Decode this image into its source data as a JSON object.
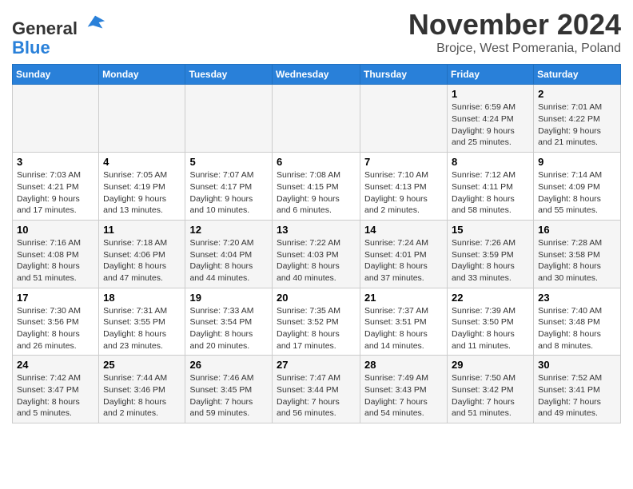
{
  "header": {
    "logo_line1": "General",
    "logo_line2": "Blue",
    "title": "November 2024",
    "subtitle": "Brojce, West Pomerania, Poland"
  },
  "weekdays": [
    "Sunday",
    "Monday",
    "Tuesday",
    "Wednesday",
    "Thursday",
    "Friday",
    "Saturday"
  ],
  "weeks": [
    {
      "days": [
        {
          "num": "",
          "info": ""
        },
        {
          "num": "",
          "info": ""
        },
        {
          "num": "",
          "info": ""
        },
        {
          "num": "",
          "info": ""
        },
        {
          "num": "",
          "info": ""
        },
        {
          "num": "1",
          "info": "Sunrise: 6:59 AM\nSunset: 4:24 PM\nDaylight: 9 hours\nand 25 minutes."
        },
        {
          "num": "2",
          "info": "Sunrise: 7:01 AM\nSunset: 4:22 PM\nDaylight: 9 hours\nand 21 minutes."
        }
      ]
    },
    {
      "days": [
        {
          "num": "3",
          "info": "Sunrise: 7:03 AM\nSunset: 4:21 PM\nDaylight: 9 hours\nand 17 minutes."
        },
        {
          "num": "4",
          "info": "Sunrise: 7:05 AM\nSunset: 4:19 PM\nDaylight: 9 hours\nand 13 minutes."
        },
        {
          "num": "5",
          "info": "Sunrise: 7:07 AM\nSunset: 4:17 PM\nDaylight: 9 hours\nand 10 minutes."
        },
        {
          "num": "6",
          "info": "Sunrise: 7:08 AM\nSunset: 4:15 PM\nDaylight: 9 hours\nand 6 minutes."
        },
        {
          "num": "7",
          "info": "Sunrise: 7:10 AM\nSunset: 4:13 PM\nDaylight: 9 hours\nand 2 minutes."
        },
        {
          "num": "8",
          "info": "Sunrise: 7:12 AM\nSunset: 4:11 PM\nDaylight: 8 hours\nand 58 minutes."
        },
        {
          "num": "9",
          "info": "Sunrise: 7:14 AM\nSunset: 4:09 PM\nDaylight: 8 hours\nand 55 minutes."
        }
      ]
    },
    {
      "days": [
        {
          "num": "10",
          "info": "Sunrise: 7:16 AM\nSunset: 4:08 PM\nDaylight: 8 hours\nand 51 minutes."
        },
        {
          "num": "11",
          "info": "Sunrise: 7:18 AM\nSunset: 4:06 PM\nDaylight: 8 hours\nand 47 minutes."
        },
        {
          "num": "12",
          "info": "Sunrise: 7:20 AM\nSunset: 4:04 PM\nDaylight: 8 hours\nand 44 minutes."
        },
        {
          "num": "13",
          "info": "Sunrise: 7:22 AM\nSunset: 4:03 PM\nDaylight: 8 hours\nand 40 minutes."
        },
        {
          "num": "14",
          "info": "Sunrise: 7:24 AM\nSunset: 4:01 PM\nDaylight: 8 hours\nand 37 minutes."
        },
        {
          "num": "15",
          "info": "Sunrise: 7:26 AM\nSunset: 3:59 PM\nDaylight: 8 hours\nand 33 minutes."
        },
        {
          "num": "16",
          "info": "Sunrise: 7:28 AM\nSunset: 3:58 PM\nDaylight: 8 hours\nand 30 minutes."
        }
      ]
    },
    {
      "days": [
        {
          "num": "17",
          "info": "Sunrise: 7:30 AM\nSunset: 3:56 PM\nDaylight: 8 hours\nand 26 minutes."
        },
        {
          "num": "18",
          "info": "Sunrise: 7:31 AM\nSunset: 3:55 PM\nDaylight: 8 hours\nand 23 minutes."
        },
        {
          "num": "19",
          "info": "Sunrise: 7:33 AM\nSunset: 3:54 PM\nDaylight: 8 hours\nand 20 minutes."
        },
        {
          "num": "20",
          "info": "Sunrise: 7:35 AM\nSunset: 3:52 PM\nDaylight: 8 hours\nand 17 minutes."
        },
        {
          "num": "21",
          "info": "Sunrise: 7:37 AM\nSunset: 3:51 PM\nDaylight: 8 hours\nand 14 minutes."
        },
        {
          "num": "22",
          "info": "Sunrise: 7:39 AM\nSunset: 3:50 PM\nDaylight: 8 hours\nand 11 minutes."
        },
        {
          "num": "23",
          "info": "Sunrise: 7:40 AM\nSunset: 3:48 PM\nDaylight: 8 hours\nand 8 minutes."
        }
      ]
    },
    {
      "days": [
        {
          "num": "24",
          "info": "Sunrise: 7:42 AM\nSunset: 3:47 PM\nDaylight: 8 hours\nand 5 minutes."
        },
        {
          "num": "25",
          "info": "Sunrise: 7:44 AM\nSunset: 3:46 PM\nDaylight: 8 hours\nand 2 minutes."
        },
        {
          "num": "26",
          "info": "Sunrise: 7:46 AM\nSunset: 3:45 PM\nDaylight: 7 hours\nand 59 minutes."
        },
        {
          "num": "27",
          "info": "Sunrise: 7:47 AM\nSunset: 3:44 PM\nDaylight: 7 hours\nand 56 minutes."
        },
        {
          "num": "28",
          "info": "Sunrise: 7:49 AM\nSunset: 3:43 PM\nDaylight: 7 hours\nand 54 minutes."
        },
        {
          "num": "29",
          "info": "Sunrise: 7:50 AM\nSunset: 3:42 PM\nDaylight: 7 hours\nand 51 minutes."
        },
        {
          "num": "30",
          "info": "Sunrise: 7:52 AM\nSunset: 3:41 PM\nDaylight: 7 hours\nand 49 minutes."
        }
      ]
    }
  ]
}
